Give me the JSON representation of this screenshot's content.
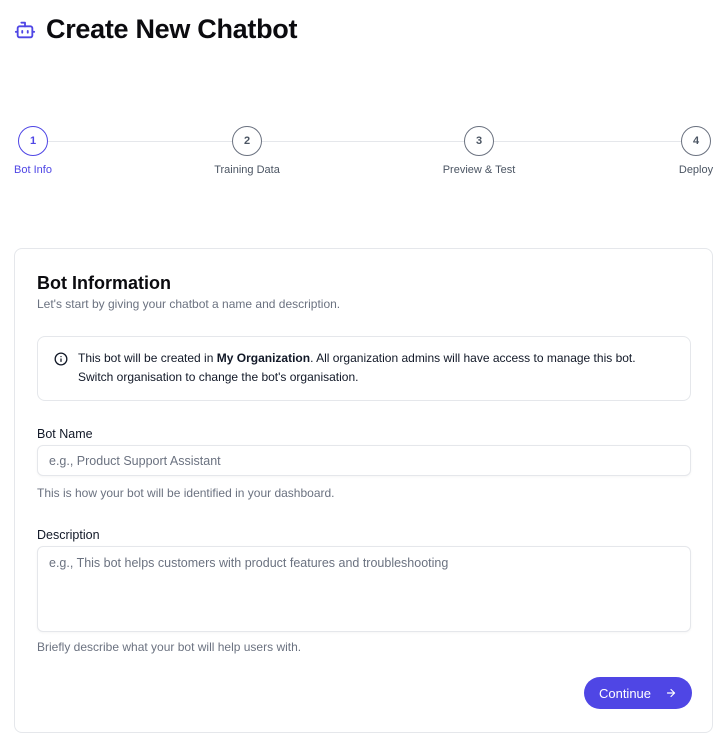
{
  "header": {
    "title": "Create New Chatbot",
    "icon": "bot-icon"
  },
  "stepper": {
    "steps": [
      {
        "number": "1",
        "label": "Bot Info",
        "active": true
      },
      {
        "number": "2",
        "label": "Training Data",
        "active": false
      },
      {
        "number": "3",
        "label": "Preview & Test",
        "active": false
      },
      {
        "number": "4",
        "label": "Deploy",
        "active": false
      }
    ]
  },
  "card": {
    "title": "Bot Information",
    "subtitle": "Let's start by giving your chatbot a name and description."
  },
  "info": {
    "icon": "info-icon",
    "text_before": "This bot will be created in ",
    "org_name": "My Organization",
    "text_after": ". All organization admins will have access to manage this bot.",
    "text_line2": "Switch organisation to change the bot's organisation."
  },
  "bot_name": {
    "label": "Bot Name",
    "placeholder": "e.g., Product Support Assistant",
    "value": "",
    "helper": "This is how your bot will be identified in your dashboard."
  },
  "description": {
    "label": "Description",
    "placeholder": "e.g., This bot helps customers with product features and troubleshooting",
    "value": "",
    "helper": "Briefly describe what your bot will help users with."
  },
  "actions": {
    "continue_label": "Continue",
    "continue_icon": "arrow-right-icon"
  },
  "colors": {
    "accent": "#4f46e5",
    "border": "#e5e7eb",
    "muted_text": "#6b7280"
  }
}
